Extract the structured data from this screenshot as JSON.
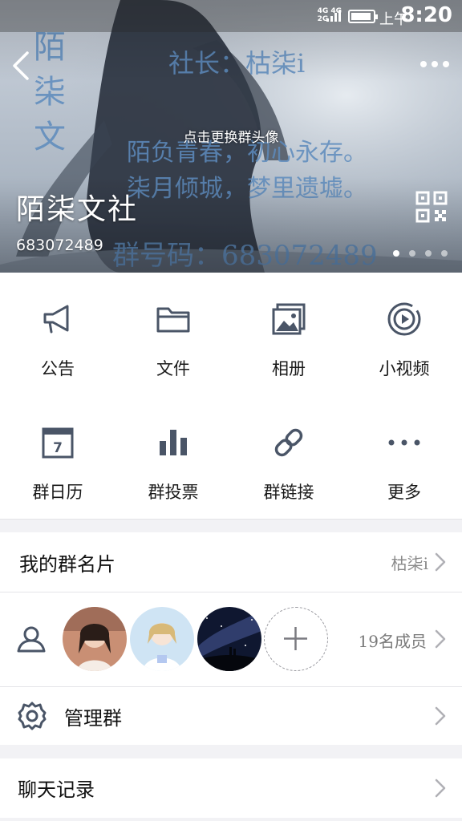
{
  "status_bar": {
    "network": "4G 4G\n2G",
    "ampm": "上午",
    "time": "8:20"
  },
  "header": {
    "change_avatar_hint": "点击更换群头像",
    "group_name": "陌柒文社",
    "group_id": "683072489",
    "banner_text": {
      "column": "陌柒文",
      "line1": "社长：枯柒i",
      "line2": "陌负青春，初心永存。",
      "line3": "柒月倾城，梦里遗墟。",
      "line4": "群号码：683072489"
    },
    "page_dots": 4,
    "active_dot": 0
  },
  "features": [
    {
      "label": "公告",
      "icon": "megaphone-icon"
    },
    {
      "label": "文件",
      "icon": "folder-icon"
    },
    {
      "label": "相册",
      "icon": "photo-album-icon"
    },
    {
      "label": "小视频",
      "icon": "video-play-icon"
    },
    {
      "label": "群日历",
      "icon": "calendar-icon"
    },
    {
      "label": "群投票",
      "icon": "bar-chart-icon"
    },
    {
      "label": "群链接",
      "icon": "link-icon"
    },
    {
      "label": "更多",
      "icon": "more-dots-icon"
    }
  ],
  "calendar_day": "7",
  "rows": {
    "card": {
      "title": "我的群名片",
      "value": "枯柒i"
    },
    "members": {
      "count_text": "19名成员"
    },
    "manage": {
      "title": "管理群"
    },
    "chat_history": {
      "title": "聊天记录"
    }
  },
  "colors": {
    "icon_gray": "#4a5567",
    "divider": "#e4e4e8",
    "background": "#f2f2f5"
  }
}
